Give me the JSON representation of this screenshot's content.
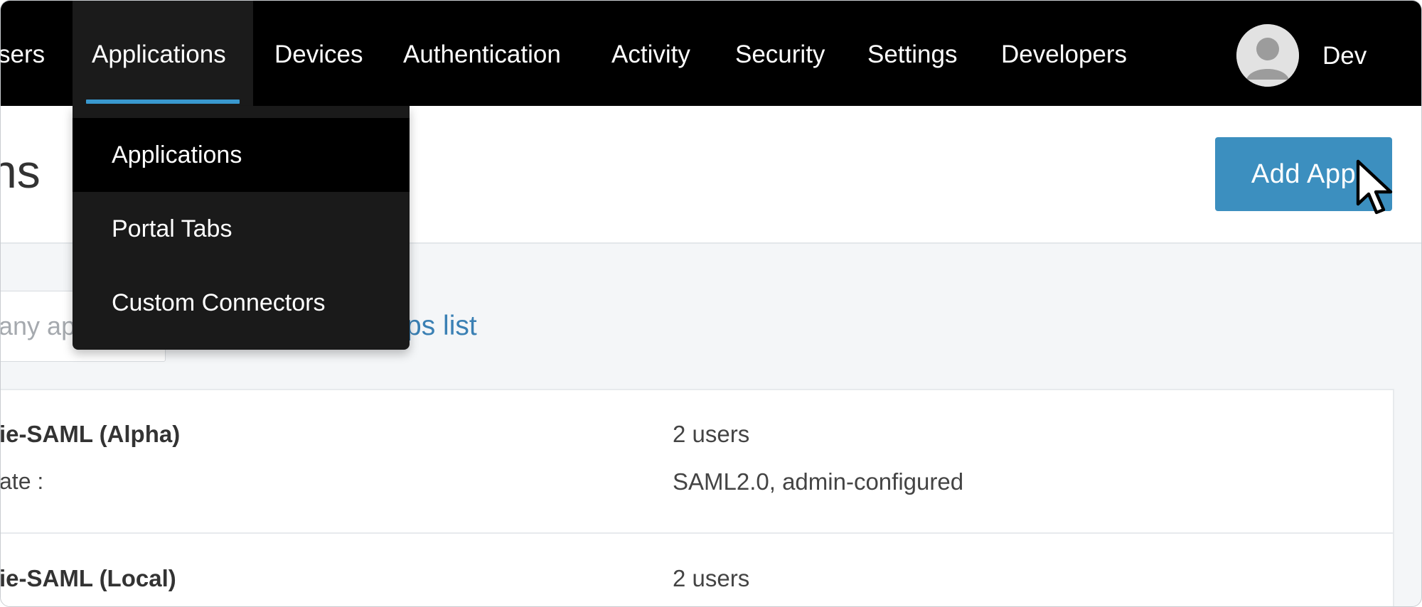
{
  "nav": {
    "items": [
      {
        "label": "sers"
      },
      {
        "label": "Applications"
      },
      {
        "label": "Devices"
      },
      {
        "label": "Authentication"
      },
      {
        "label": "Activity"
      },
      {
        "label": "Security"
      },
      {
        "label": "Settings"
      },
      {
        "label": "Developers"
      }
    ],
    "active_index": 1,
    "user_name": "Dev",
    "accent_color": "#3a9ad1"
  },
  "dropdown": {
    "items": [
      {
        "label": "Applications"
      },
      {
        "label": "Portal Tabs"
      },
      {
        "label": "Custom Connectors"
      }
    ],
    "selected_index": 0
  },
  "header": {
    "title": "ns",
    "add_button_label": "Add App",
    "button_color": "#3c8fbf"
  },
  "toolbar": {
    "search_placeholder": "any ap",
    "link_label": "ps list"
  },
  "table": {
    "rows": [
      {
        "name": "ie-SAML (Alpha)",
        "sub": "ate :",
        "users": "2 users",
        "type": "SAML2.0, admin-configured"
      },
      {
        "name": "ie-SAML (Local)",
        "users": "2 users"
      }
    ]
  },
  "icons": {
    "avatar": "user-avatar-icon",
    "cursor": "mouse-pointer-icon"
  }
}
